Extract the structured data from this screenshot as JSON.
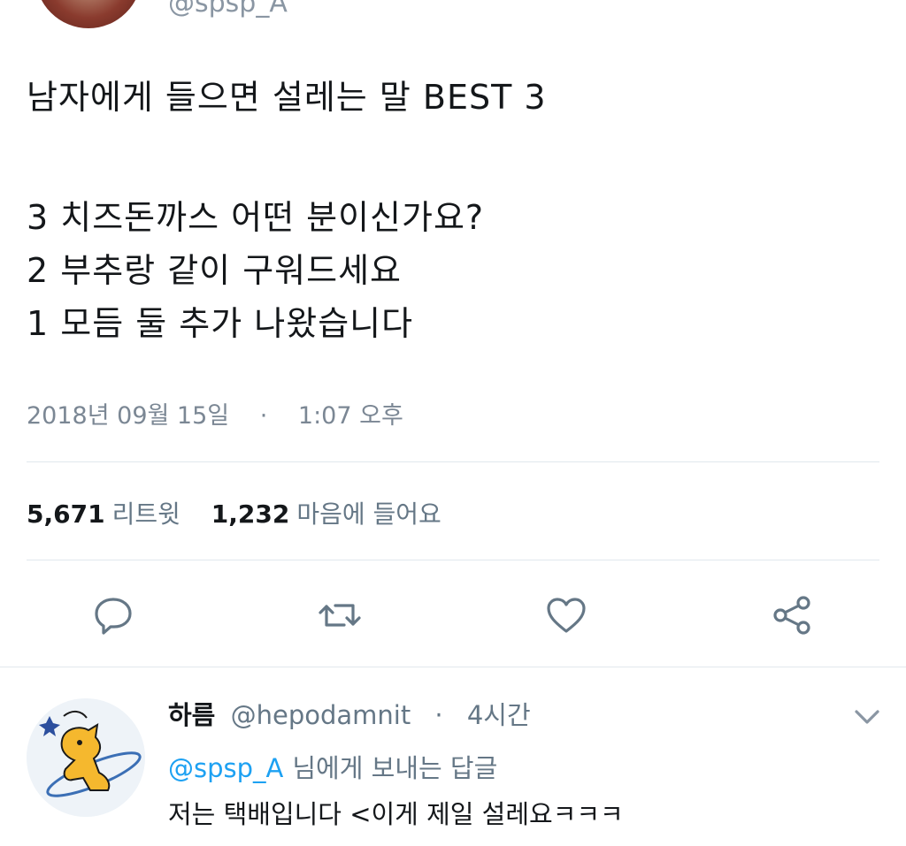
{
  "tweet": {
    "handle": "@spsp_A",
    "lines": [
      "남자에게 들으면 설레는 말 BEST 3",
      "3 치즈돈까스 어떤 분이신가요?",
      "2 부추랑 같이 구워드세요",
      "1 모듬 둘 추가 나왔습니다"
    ],
    "date": "2018년 09월 15일",
    "separator": "·",
    "time": "1:07 오후",
    "retweet_count": "5,671",
    "retweet_label": "리트윗",
    "like_count": "1,232",
    "like_label": "마음에 들어요"
  },
  "actions": [
    {
      "icon": "reply-icon"
    },
    {
      "icon": "retweet-icon"
    },
    {
      "icon": "like-icon"
    },
    {
      "icon": "share-icon"
    }
  ],
  "reply": {
    "name": "하름",
    "handle": "@hepodamnit",
    "separator": "·",
    "time": "4시간",
    "replying_to": "@spsp_A",
    "replying_suffix": "님에게 보내는 답글",
    "text": "저는 택배입니다 <이게 제일 설레요ㅋㅋㅋ"
  },
  "colors": {
    "accent": "#1da1f2",
    "text": "#14171a",
    "muted": "#657786",
    "icon": "#657786",
    "divider": "#e1e8ed"
  }
}
